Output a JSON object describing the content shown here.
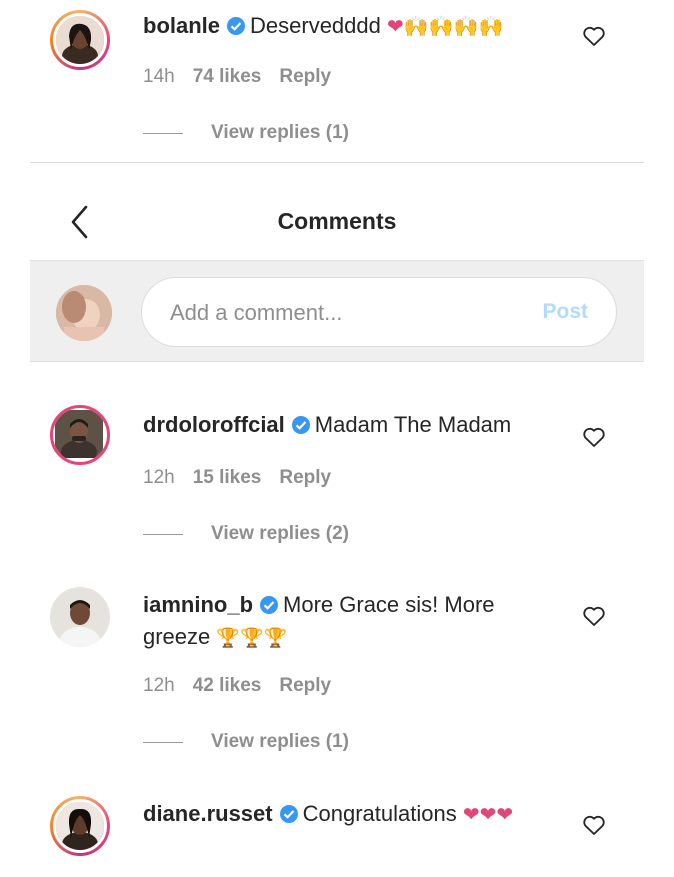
{
  "comments": [
    {
      "username": "bolanle",
      "text": "Deservedddd",
      "emojis": "❤🙌🙌🙌🙌",
      "time": "14h",
      "likes": "74 likes",
      "reply": "Reply",
      "view_replies": "View replies (1)"
    },
    {
      "username": "drdoloroffcial",
      "text": "Madam The Madam",
      "time": "12h",
      "likes": "15 likes",
      "reply": "Reply",
      "view_replies": "View replies (2)"
    },
    {
      "username": "iamnino_b",
      "text": "More Grace sis! More greeze",
      "emojis": "🏆🏆🏆",
      "time": "12h",
      "likes": "42 likes",
      "reply": "Reply",
      "view_replies": "View replies (1)"
    },
    {
      "username": "diane.russet",
      "text": "Congratulations",
      "emojis": "❤❤❤"
    }
  ],
  "header": {
    "title": "Comments"
  },
  "composer": {
    "placeholder": "Add a comment...",
    "post_label": "Post"
  },
  "colors": {
    "verified": "#3897f0",
    "heart_emoji": "#e0457b",
    "post": "#b3dbff",
    "meta": "#8e8e8e"
  },
  "icons": {
    "back": "chevron-left-icon",
    "like": "heart-outline-icon",
    "verified": "verified-badge-icon"
  }
}
